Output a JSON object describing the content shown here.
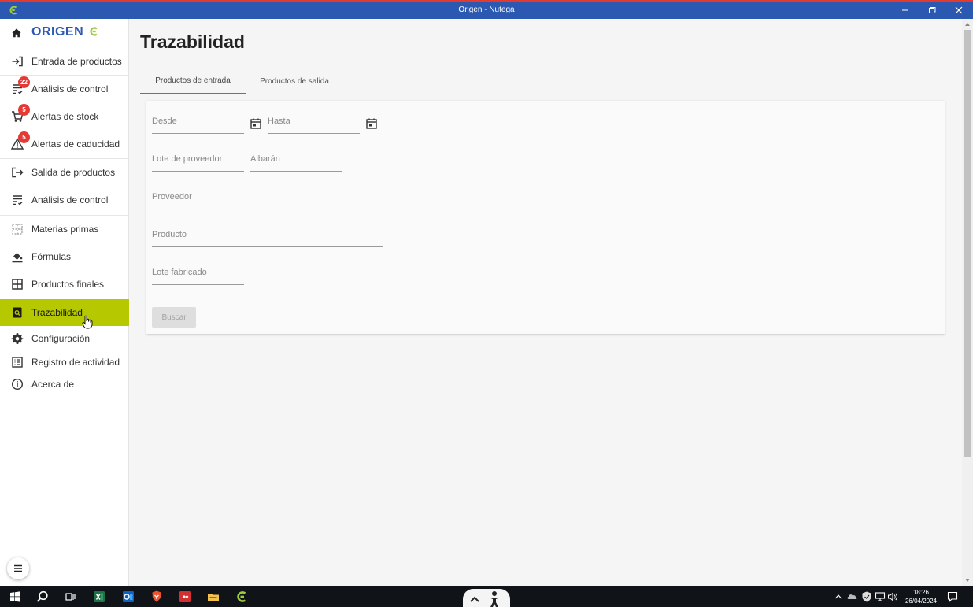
{
  "window": {
    "title": "Origen - Nutega"
  },
  "brand": {
    "name": "ORIGEN"
  },
  "sidebar": {
    "items": [
      {
        "label": "Entrada de productos",
        "icon": "login-arrow-icon"
      },
      {
        "label": "Análisis de control",
        "icon": "list-check-icon",
        "badge": "22"
      },
      {
        "label": "Alertas de stock",
        "icon": "cart-icon",
        "badge": "5"
      },
      {
        "label": "Alertas de caducidad",
        "icon": "warning-icon",
        "badge": "5"
      },
      {
        "label": "Salida de productos",
        "icon": "logout-arrow-icon"
      },
      {
        "label": "Análisis de control",
        "icon": "list-check-icon"
      },
      {
        "label": "Materias primas",
        "icon": "grid-dotted-icon"
      },
      {
        "label": "Fórmulas",
        "icon": "paint-bucket-icon"
      },
      {
        "label": "Productos finales",
        "icon": "grid-icon"
      },
      {
        "label": "Trazabilidad",
        "icon": "search-doc-icon",
        "active": true
      },
      {
        "label": "Configuración",
        "icon": "gear-icon"
      },
      {
        "label": "Registro de actividad",
        "icon": "log-icon"
      },
      {
        "label": "Acerca de",
        "icon": "info-icon"
      }
    ]
  },
  "main": {
    "title": "Trazabilidad",
    "tabs": [
      {
        "label": "Productos de entrada",
        "active": true
      },
      {
        "label": "Productos de salida",
        "active": false
      }
    ],
    "form": {
      "desde": {
        "placeholder": "Desde",
        "value": ""
      },
      "hasta": {
        "placeholder": "Hasta",
        "value": ""
      },
      "lote_proveedor": {
        "placeholder": "Lote de proveedor",
        "value": ""
      },
      "albaran": {
        "placeholder": "Albarán",
        "value": ""
      },
      "proveedor": {
        "placeholder": "Proveedor",
        "value": ""
      },
      "producto": {
        "placeholder": "Producto",
        "value": ""
      },
      "lote_fabricado": {
        "placeholder": "Lote fabricado",
        "value": ""
      },
      "search_label": "Buscar"
    }
  },
  "taskbar": {
    "time": "18:26",
    "date": "26/04/2024"
  },
  "colors": {
    "titlebar": "#2b59b2",
    "accent": "#b5c800",
    "badge": "#e53935",
    "tab_indicator": "#6f63c6"
  }
}
